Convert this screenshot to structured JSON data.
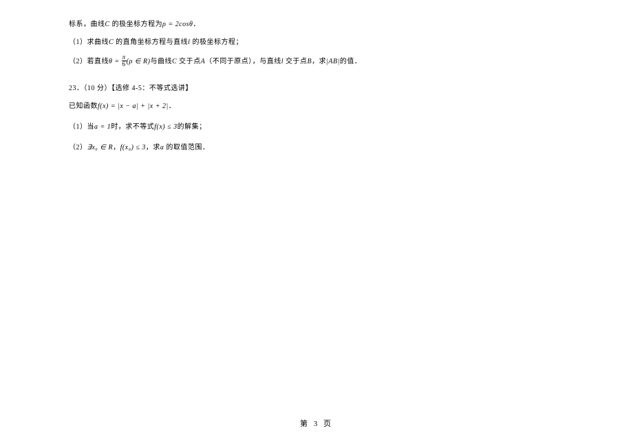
{
  "lines": {
    "l1_pre": "标系，曲线",
    "l1_c": "C",
    "l1_mid": " 的极坐标方程为",
    "l1_eq": "ρ = 2cosθ",
    "l1_post": "．",
    "l2_pre": "（1）求曲线",
    "l2_c": "C",
    "l2_mid": " 的直角坐标方程与直线",
    "l2_l": "l",
    "l2_post": " 的极坐标方程；",
    "l3_pre": "（2）若直线",
    "l3_theta": "θ = ",
    "l3_frac_num": "π",
    "l3_frac_den": "6",
    "l3_paren": "(ρ ∈ R)",
    "l3_mid1": "与曲线",
    "l3_c": "C",
    "l3_mid2": " 交于点",
    "l3_a": "A",
    "l3_note": "（不同于原点），与直线",
    "l3_l": "l",
    "l3_mid3": " 交于点",
    "l3_b": "B",
    "l3_mid4": "，求",
    "l3_ab": "|AB|",
    "l3_post": "的值．",
    "l4": "23．（10 分）【选修 4-5：不等式选讲】",
    "l5_pre": "已知函数",
    "l5_fx": "f(x) = |x − a| + |x + 2|",
    "l5_post": "．",
    "l6_pre": "（1）当",
    "l6_a": "a = 1",
    "l6_mid": "时，求不等式",
    "l6_fx": "f(x) ≤ 3",
    "l6_post": "的解集；",
    "l7_pre": "（2）",
    "l7_exist": "∃x₀ ∈ R",
    "l7_comma": "，",
    "l7_fx": "f(x₀) ≤ 3",
    "l7_mid": "，求",
    "l7_a": "a",
    "l7_post": " 的取值范围．"
  },
  "footer": "第  3  页"
}
